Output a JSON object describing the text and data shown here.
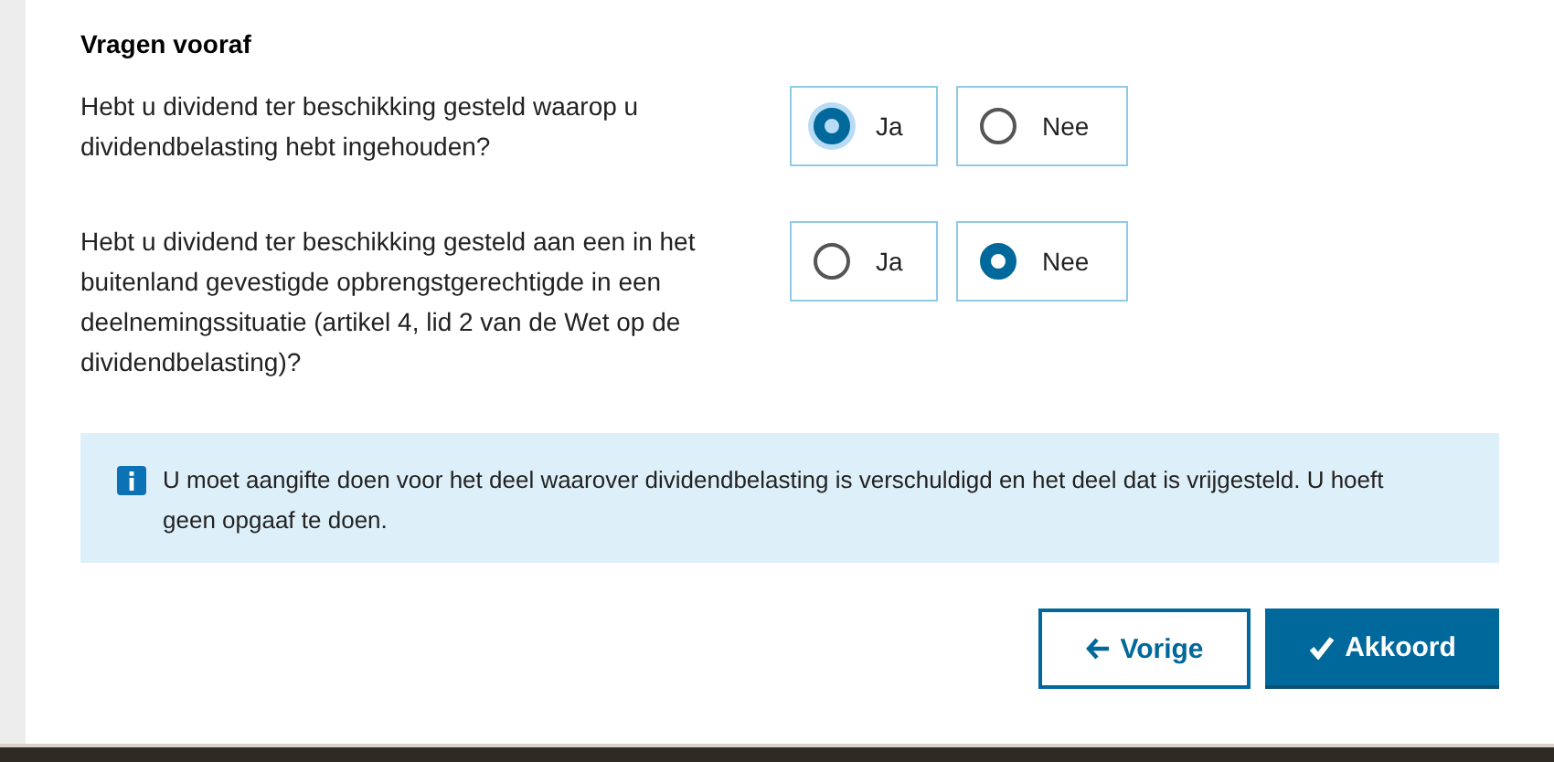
{
  "section_title": "Vragen vooraf",
  "questions": [
    {
      "text": "Hebt u dividend ter beschikking gesteld waarop u dividendbelasting hebt ingehouden?",
      "options": [
        {
          "label": "Ja",
          "selected": true,
          "focused": true
        },
        {
          "label": "Nee",
          "selected": false,
          "focused": false
        }
      ]
    },
    {
      "text": "Hebt u dividend ter beschikking gesteld aan een in het buitenland gevestigde opbrengstgerechtigde in een deelnemingssituatie (artikel 4, lid 2 van de Wet op de dividendbelasting)?",
      "options": [
        {
          "label": "Ja",
          "selected": false,
          "focused": false
        },
        {
          "label": "Nee",
          "selected": true,
          "focused": false
        }
      ]
    }
  ],
  "info": {
    "text": "U moet aangifte doen voor het deel waarover dividendbelasting is verschuldigd en het deel dat is vrijgesteld. U hoeft geen opgaaf te doen."
  },
  "buttons": [
    {
      "label": "Vorige",
      "kind": "secondary"
    },
    {
      "label": "Akkoord",
      "kind": "primary"
    }
  ]
}
